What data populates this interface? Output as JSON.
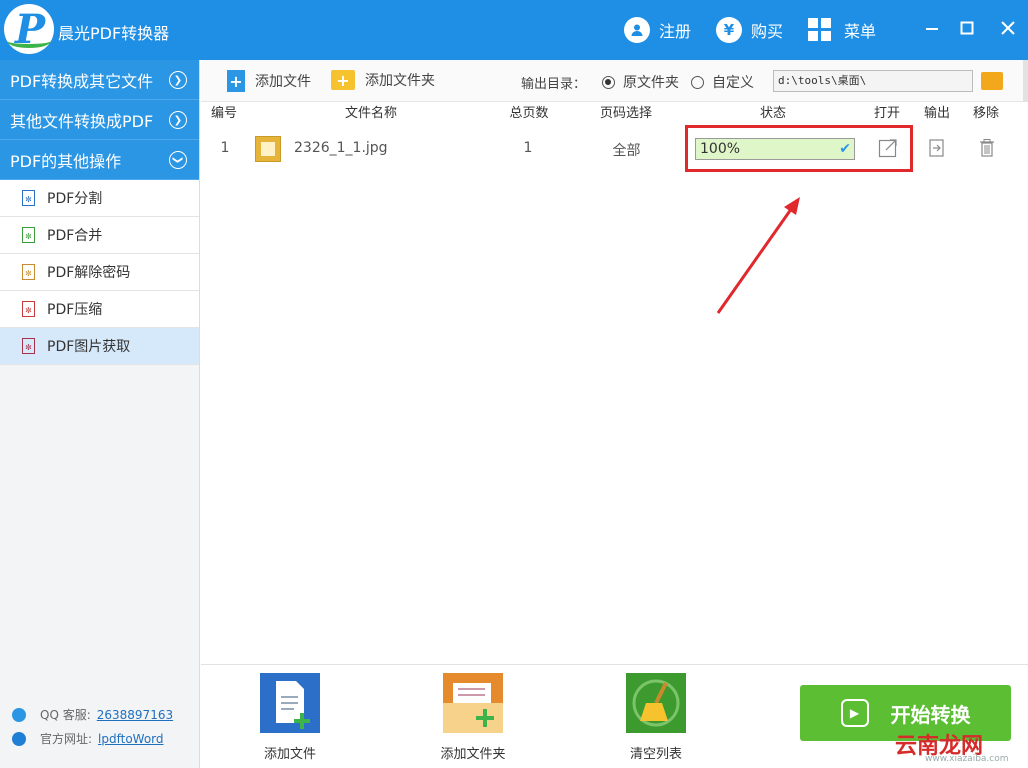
{
  "app": {
    "title": "晨光PDF转换器"
  },
  "header": {
    "register": "注册",
    "buy": "购买",
    "menu": "菜单",
    "buy_symbol": "¥"
  },
  "sidebar": {
    "categories": [
      {
        "label": "PDF转换成其它文件"
      },
      {
        "label": "其他文件转换成PDF"
      },
      {
        "label": "PDF的其他操作"
      }
    ],
    "items": [
      {
        "label": "PDF分割"
      },
      {
        "label": "PDF合并"
      },
      {
        "label": "PDF解除密码"
      },
      {
        "label": "PDF压缩"
      },
      {
        "label": "PDF图片获取"
      }
    ],
    "qq_label": "QQ 客服:",
    "qq_value": "2638897163",
    "site_label": "官方网址:",
    "site_value": "lpdftoWord"
  },
  "toolbar": {
    "add_file": "添加文件",
    "add_folder": "添加文件夹",
    "output_label": "输出目录：",
    "radio_original": "原文件夹",
    "radio_custom": "自定义",
    "output_path": "d:\\tools\\桌面\\"
  },
  "table": {
    "headers": [
      "编号",
      "文件名称",
      "总页数",
      "页码选择",
      "状态",
      "打开",
      "输出",
      "移除"
    ],
    "rows": [
      {
        "index": "1",
        "name": "2326_1_1.jpg",
        "pages": "1",
        "range": "全部",
        "status": "100%"
      }
    ]
  },
  "bottom": {
    "add_file": "添加文件",
    "add_folder": "添加文件夹",
    "clear_list": "清空列表",
    "start": "开始转换"
  },
  "watermark": {
    "text": "云南龙网",
    "sub": "www.xiazaiba.com"
  },
  "colors": {
    "primary": "#1f8fe5",
    "start": "#5cbf33",
    "highlight": "#e0282d",
    "status_bg": "#dff6c9"
  }
}
